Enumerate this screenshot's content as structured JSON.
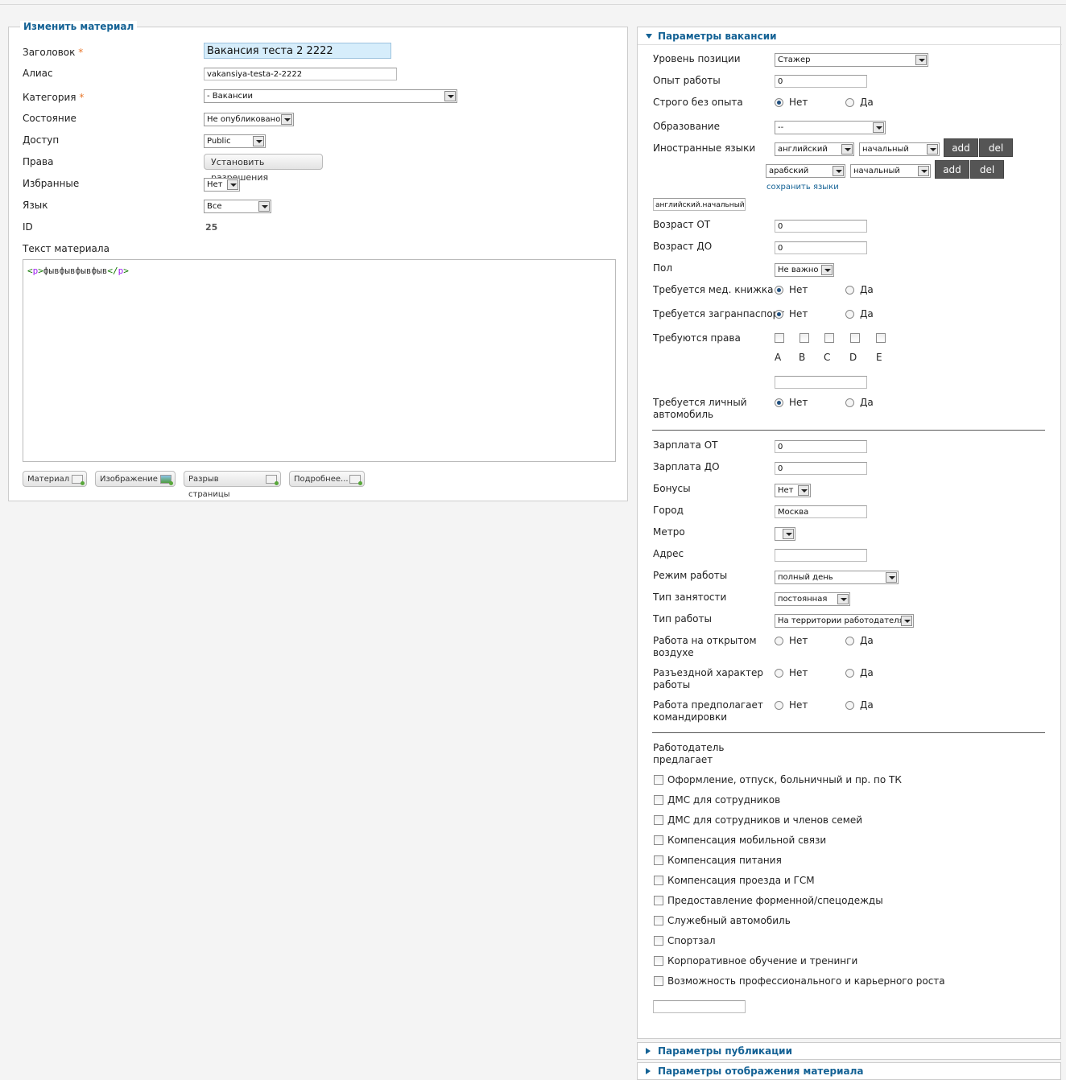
{
  "edit_section": {
    "legend": "Изменить материал",
    "title_label": "Заголовок",
    "required_mark": "*",
    "title_value": "Вакансия теста 2 2222",
    "alias_label": "Алиас",
    "alias_value": "vakansiya-testa-2-2222",
    "category_label": "Категория",
    "category_value": "- Вакансии",
    "state_label": "Состояние",
    "state_value": "Не опубликовано",
    "access_label": "Доступ",
    "access_value": "Public",
    "rights_label": "Права",
    "rights_button": "Установить разрешения",
    "featured_label": "Избранные",
    "featured_value": "Нет",
    "language_label": "Язык",
    "language_value": "Все",
    "id_label": "ID",
    "id_value": "25",
    "text_label": "Текст материала",
    "editor": {
      "open_lt": "<",
      "tag": "p",
      "gt": ">",
      "content": "фывфывфывфыв",
      "close_lt": "</",
      "close_gt": ">"
    },
    "buttons": [
      "Материал",
      "Изображение",
      "Разрыв страницы",
      "Подробнее..."
    ]
  },
  "vacancy": {
    "header": "Параметры вакансии",
    "yes": "Да",
    "no": "Нет",
    "position_level_label": "Уровень позиции",
    "position_level_value": "Стажер",
    "experience_label": "Опыт работы",
    "experience_value": "0",
    "strict_no_exp_label": "Строго без опыта",
    "education_label": "Образование",
    "education_value": "--",
    "languages_label": "Иностранные языки",
    "lang_rows": [
      {
        "language": "английский",
        "level": "начальный"
      },
      {
        "language": "арабский",
        "level": "начальный"
      }
    ],
    "add_button": "add",
    "del_button": "del",
    "save_languages_link": "сохранить языки",
    "languages_result": "английский.начальный",
    "age_from_label": "Возраст ОТ",
    "age_from_value": "0",
    "age_to_label": "Возраст ДО",
    "age_to_value": "0",
    "gender_label": "Пол",
    "gender_value": "Не важно",
    "med_book_label": "Требуется мед. книжка",
    "passport_label": "Требуется загранпаспорт",
    "license_label": "Требуются права",
    "license_categories": [
      "A",
      "B",
      "C",
      "D",
      "E"
    ],
    "car_label_1": "Требуется личный",
    "car_label_2": "автомобиль",
    "salary_from_label": "Зарплата ОТ",
    "salary_from_value": "0",
    "salary_to_label": "Зарплата ДО",
    "salary_to_value": "0",
    "bonuses_label": "Бонусы",
    "bonuses_value": "Нет",
    "city_label": "Город",
    "city_value": "Москва",
    "metro_label": "Метро",
    "address_label": "Адрес",
    "work_mode_label": "Режим работы",
    "work_mode_value": "полный день",
    "employment_type_label": "Тип занятости",
    "employment_type_value": "постоянная",
    "work_type_label": "Тип работы",
    "work_type_value": "На территории работодателя",
    "outdoor_label_1": "Работа на открытом",
    "outdoor_label_2": "воздухе",
    "traveling_label_1": "Разъездной характер",
    "traveling_label_2": "работы",
    "trips_label_1": "Работа предполагает",
    "trips_label_2": "командировки",
    "employer_offers_1": "Работодатель",
    "employer_offers_2": "предлагает",
    "benefits": [
      "Оформление, отпуск, больничный и пр. по ТК",
      "ДМС для сотрудников",
      "ДМС для сотрудников и членов семей",
      "Компенсация мобильной связи",
      "Компенсация питания",
      "Компенсация проезда и ГСМ",
      "Предоставление форменной/спецодежды",
      "Служебный автомобиль",
      "Спортзал",
      "Корпоративное обучение и тренинги",
      "Возможность профессионального и карьерного роста"
    ]
  },
  "publication_header": "Параметры публикации",
  "display_header": "Параметры отображения материала",
  "colors": {
    "accent": "#146295",
    "required": "#e8772c",
    "dark_button": "#555555"
  }
}
